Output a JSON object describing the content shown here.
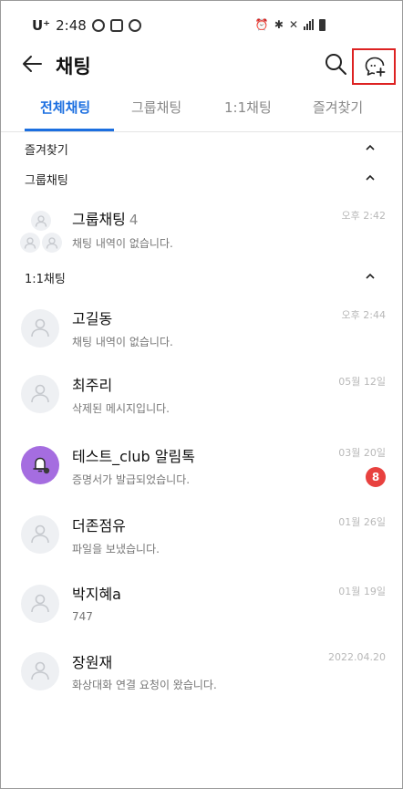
{
  "status_bar": {
    "carrier": "U⁺",
    "time": "2:48"
  },
  "header": {
    "title": "채팅"
  },
  "tabs": [
    {
      "label": "전체채팅",
      "active": true
    },
    {
      "label": "그룹채팅",
      "active": false
    },
    {
      "label": "1:1채팅",
      "active": false
    },
    {
      "label": "즐겨찾기",
      "active": false
    }
  ],
  "sections": {
    "favorites": {
      "label": "즐겨찾기"
    },
    "group": {
      "label": "그룹채팅"
    },
    "direct": {
      "label": "1:1채팅"
    }
  },
  "group_chats": [
    {
      "name": "그룹채팅",
      "count": "4",
      "message": "채팅 내역이 없습니다.",
      "time": "오후 2:42"
    }
  ],
  "direct_chats": [
    {
      "name": "고길동",
      "message": "채팅 내역이 없습니다.",
      "time": "오후 2:44",
      "badge": ""
    },
    {
      "name": "최주리",
      "message": "삭제된 메시지입니다.",
      "time": "05월 12일",
      "badge": ""
    },
    {
      "name": "테스트_club 알림톡",
      "message": "증명서가 발급되었습니다.",
      "time": "03월 20일",
      "badge": "8"
    },
    {
      "name": "더존점유",
      "message": "파일을 보냈습니다.",
      "time": "01월 26일",
      "badge": ""
    },
    {
      "name": "박지혜a",
      "message": "747",
      "time": "01월 19일",
      "badge": ""
    },
    {
      "name": "장원재",
      "message": "화상대화 연결 요청이 왔습니다.",
      "time": "2022.04.20",
      "badge": ""
    }
  ],
  "colors": {
    "accent": "#1c6fe0",
    "badge": "#e8413f",
    "bot_avatar": "#a56de0",
    "highlight_box": "#dd2222"
  },
  "icons": {
    "back": "arrow-left-icon",
    "search": "search-icon",
    "new_chat": "chat-bubble-plus-icon",
    "collapse": "chevron-up-icon",
    "avatar": "person-icon",
    "bot": "bell-icon"
  }
}
